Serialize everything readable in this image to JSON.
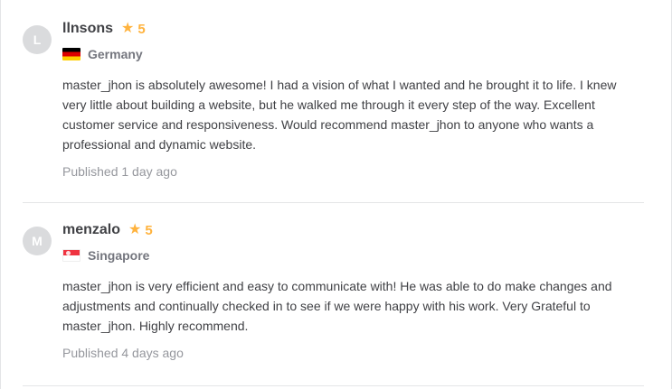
{
  "reviews": [
    {
      "avatar_letter": "L",
      "username": "llnsons",
      "rating": "5",
      "country": "Germany",
      "flag_icon": "germany-flag-icon",
      "text": "master_jhon is absolutely awesome! I had a vision of what I wanted and he brought it to life. I knew very little about building a website, but he walked me through it every step of the way. Excellent customer service and responsiveness. Would recommend master_jhon to anyone who wants a professional and dynamic website.",
      "published": "Published 1 day ago"
    },
    {
      "avatar_letter": "M",
      "username": "menzalo",
      "rating": "5",
      "country": "Singapore",
      "flag_icon": "singapore-flag-icon",
      "text": "master_jhon is very efficient and easy to communicate with! He was able to do make changes and adjustments and continually checked in to see if we were happy with his work. Very Grateful to master_jhon. Highly recommend.",
      "published": "Published 4 days ago"
    }
  ],
  "star_icon": "★",
  "colors": {
    "star": "#ffb33e",
    "avatar_bg": "#dadbdd",
    "text": "#404145",
    "muted": "#95979d"
  }
}
